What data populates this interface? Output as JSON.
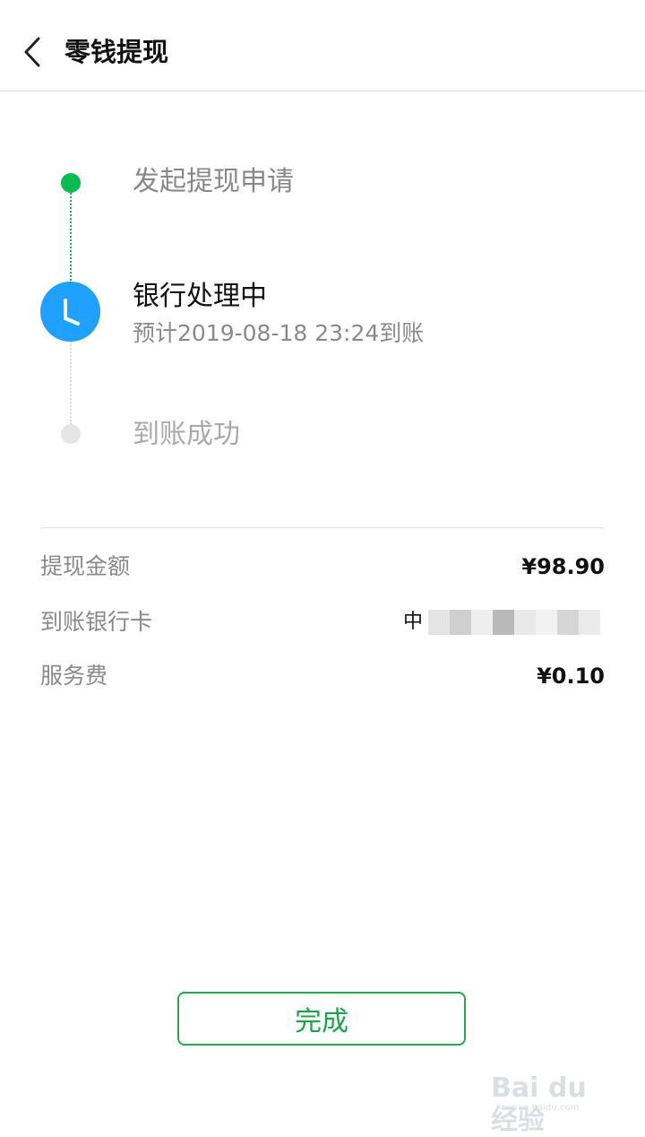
{
  "header": {
    "title": "零钱提现"
  },
  "timeline": {
    "steps": [
      {
        "label": "发起提现申请",
        "status": "done"
      },
      {
        "label": "银行处理中",
        "sub": "预计2019-08-18 23:24到账",
        "status": "current"
      },
      {
        "label": "到账成功",
        "status": "pending"
      }
    ]
  },
  "details": {
    "amount_label": "提现金额",
    "amount_value": "¥98.90",
    "card_label": "到账银行卡",
    "card_value_visible": "中",
    "fee_label": "服务费",
    "fee_value": "¥0.10"
  },
  "footer": {
    "done_label": "完成"
  },
  "watermark": {
    "text": "Bai du 经验",
    "sub": "jingyan.baidu.com"
  },
  "colors": {
    "accent_green": "#09bb51",
    "clock_blue": "#20a0ff",
    "button_border": "#2aa74c"
  },
  "icons": {
    "back": "chevron-left-icon",
    "clock": "clock-icon"
  }
}
